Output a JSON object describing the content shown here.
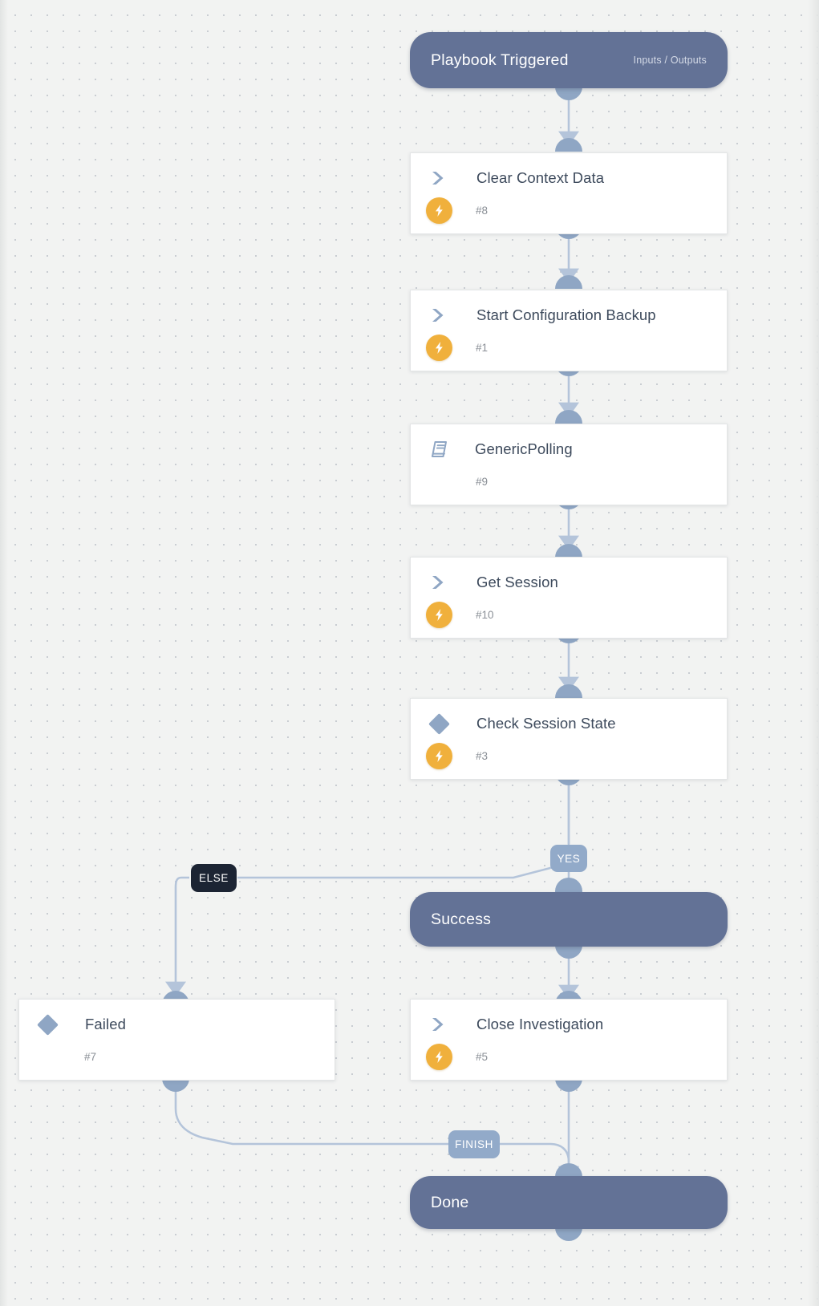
{
  "canvas": {
    "background_color": "#f2f3f2",
    "grid_dot_color": "#c9cdd2",
    "accent_node_color": "#637296",
    "connector_color": "#b4c4da",
    "socket_color": "#8fa6c4",
    "badge_color": "#f0b03c",
    "label_light_color": "#92aac9",
    "label_dark_color": "#1c2433"
  },
  "nodes": {
    "trigger": {
      "title": "Playbook Triggered",
      "meta": "Inputs / Outputs",
      "type": "start"
    },
    "clear_context": {
      "title": "Clear Context Data",
      "number": "#8",
      "icon": "chevron-right-icon",
      "has_bolt": true
    },
    "start_backup": {
      "title": "Start Configuration Backup",
      "number": "#1",
      "icon": "chevron-right-icon",
      "has_bolt": true
    },
    "generic_polling": {
      "title": "GenericPolling",
      "number": "#9",
      "icon": "playbook-book-icon",
      "has_bolt": false
    },
    "get_session": {
      "title": "Get Session",
      "number": "#10",
      "icon": "chevron-right-icon",
      "has_bolt": true
    },
    "check_session_state": {
      "title": "Check Session State",
      "number": "#3",
      "icon": "condition-diamond-icon",
      "has_bolt": true
    },
    "success": {
      "title": "Success",
      "type": "status"
    },
    "failed": {
      "title": "Failed",
      "number": "#7",
      "icon": "condition-diamond-icon",
      "has_bolt": false
    },
    "close_investigation": {
      "title": "Close Investigation",
      "number": "#5",
      "icon": "chevron-right-icon",
      "has_bolt": true
    },
    "done": {
      "title": "Done",
      "type": "status"
    }
  },
  "edge_labels": {
    "yes": "YES",
    "else": "ELSE",
    "finish": "FINISH"
  }
}
